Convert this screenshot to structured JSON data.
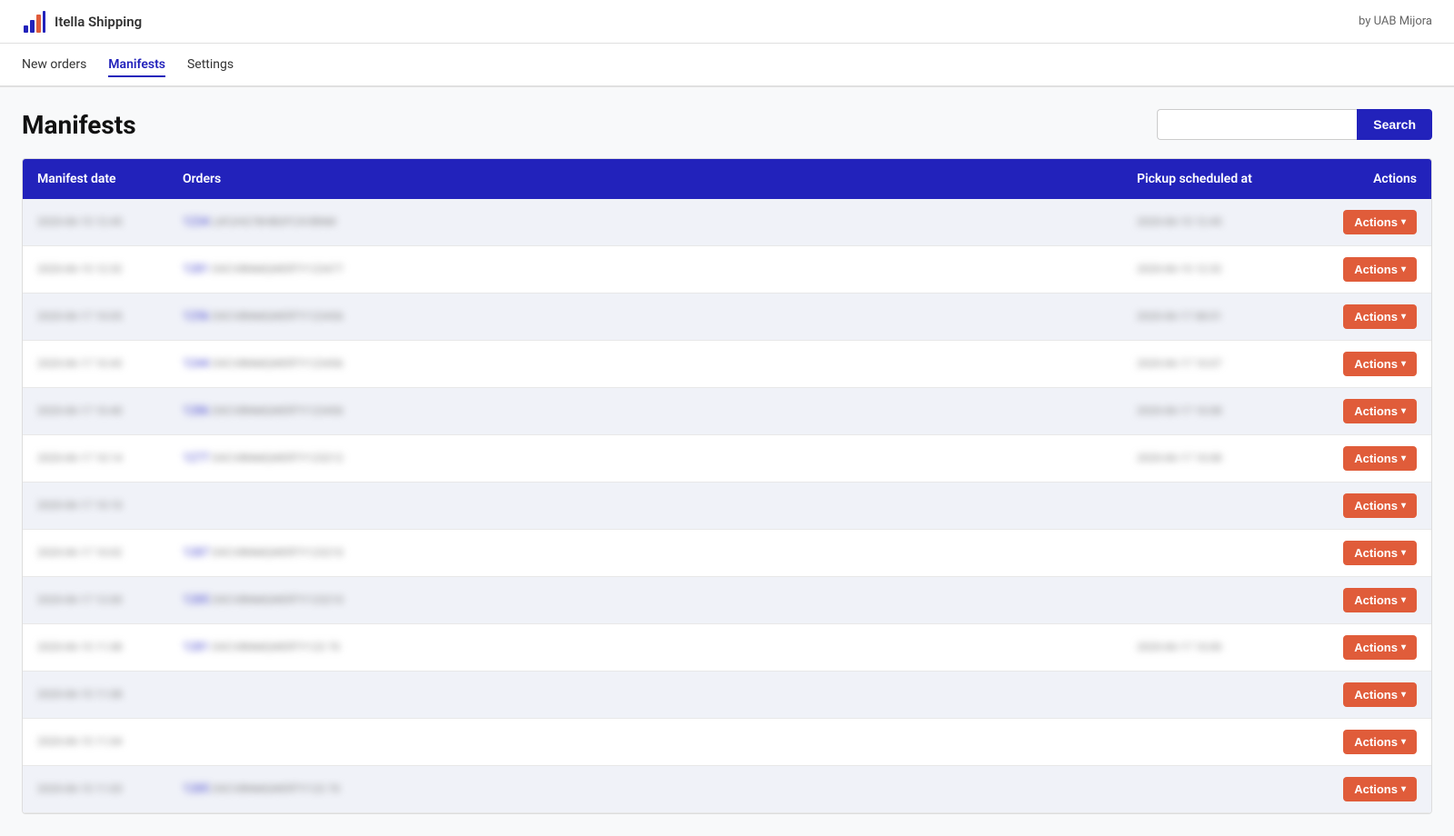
{
  "topbar": {
    "brand_name": "Itella Shipping",
    "credit": "by UAB Mijora"
  },
  "nav": {
    "items": [
      {
        "label": "New orders",
        "active": false
      },
      {
        "label": "Manifests",
        "active": true
      },
      {
        "label": "Settings",
        "active": false
      }
    ]
  },
  "page": {
    "title": "Manifests",
    "search_placeholder": "",
    "search_btn": "Search"
  },
  "table": {
    "headers": [
      "Manifest date",
      "Orders",
      "Pickup scheduled at",
      "Actions"
    ],
    "rows": [
      {
        "date": "2020-06-15 12:45",
        "orders": "1234 LKFJHG78HBGFCXVBNM",
        "pickup": "2020-06-15 12:45",
        "has_pickup": true
      },
      {
        "date": "2020-06-15 12:32",
        "orders": "1281 DXCVBNMQWERTY123477",
        "pickup": "2020-06-15 12:32",
        "has_pickup": true
      },
      {
        "date": "2020-06-17 10:05",
        "orders": "1256 DXCVBNMQWERTY123456",
        "pickup": "2020-06-17 08:01",
        "has_pickup": true
      },
      {
        "date": "2020-06-17 10:43",
        "orders": "1244 DXCVBNMQWERTY123456",
        "pickup": "2020-06-17 10:07",
        "has_pickup": true
      },
      {
        "date": "2020-06-17 10:40",
        "orders": "1286 DXCVBNMQWERTY123456",
        "pickup": "2020-06-17 10:08",
        "has_pickup": true
      },
      {
        "date": "2020-06-17 10:14",
        "orders": "1277 DXCVBNMQWERTY123212",
        "pickup": "2020-06-17 10:08",
        "has_pickup": true
      },
      {
        "date": "2020-06-17 10:10",
        "orders": "",
        "pickup": "",
        "has_pickup": false
      },
      {
        "date": "2020-06-17 10:02",
        "orders": "1287 DXCVBNMQWERTY123210",
        "pickup": "",
        "has_pickup": false
      },
      {
        "date": "2020-06-17 12:00",
        "orders": "1285 DXCVBNMQWERTY123210",
        "pickup": "",
        "has_pickup": false
      },
      {
        "date": "2020-06-15 11:08",
        "orders": "1281 DXCVBNMQWERTY123 70",
        "pickup": "2020-06-17 10:00",
        "has_pickup": true
      },
      {
        "date": "2020-06-15 11:08",
        "orders": "",
        "pickup": "",
        "has_pickup": false
      },
      {
        "date": "2020-06-15 11:04",
        "orders": "",
        "pickup": "",
        "has_pickup": false
      },
      {
        "date": "2020-06-15 11:03",
        "orders": "1285 DXCVBNMQWERTY123 70",
        "pickup": "",
        "has_pickup": false
      }
    ],
    "actions_btn_label": "Actions",
    "actions_caret": "▾"
  }
}
